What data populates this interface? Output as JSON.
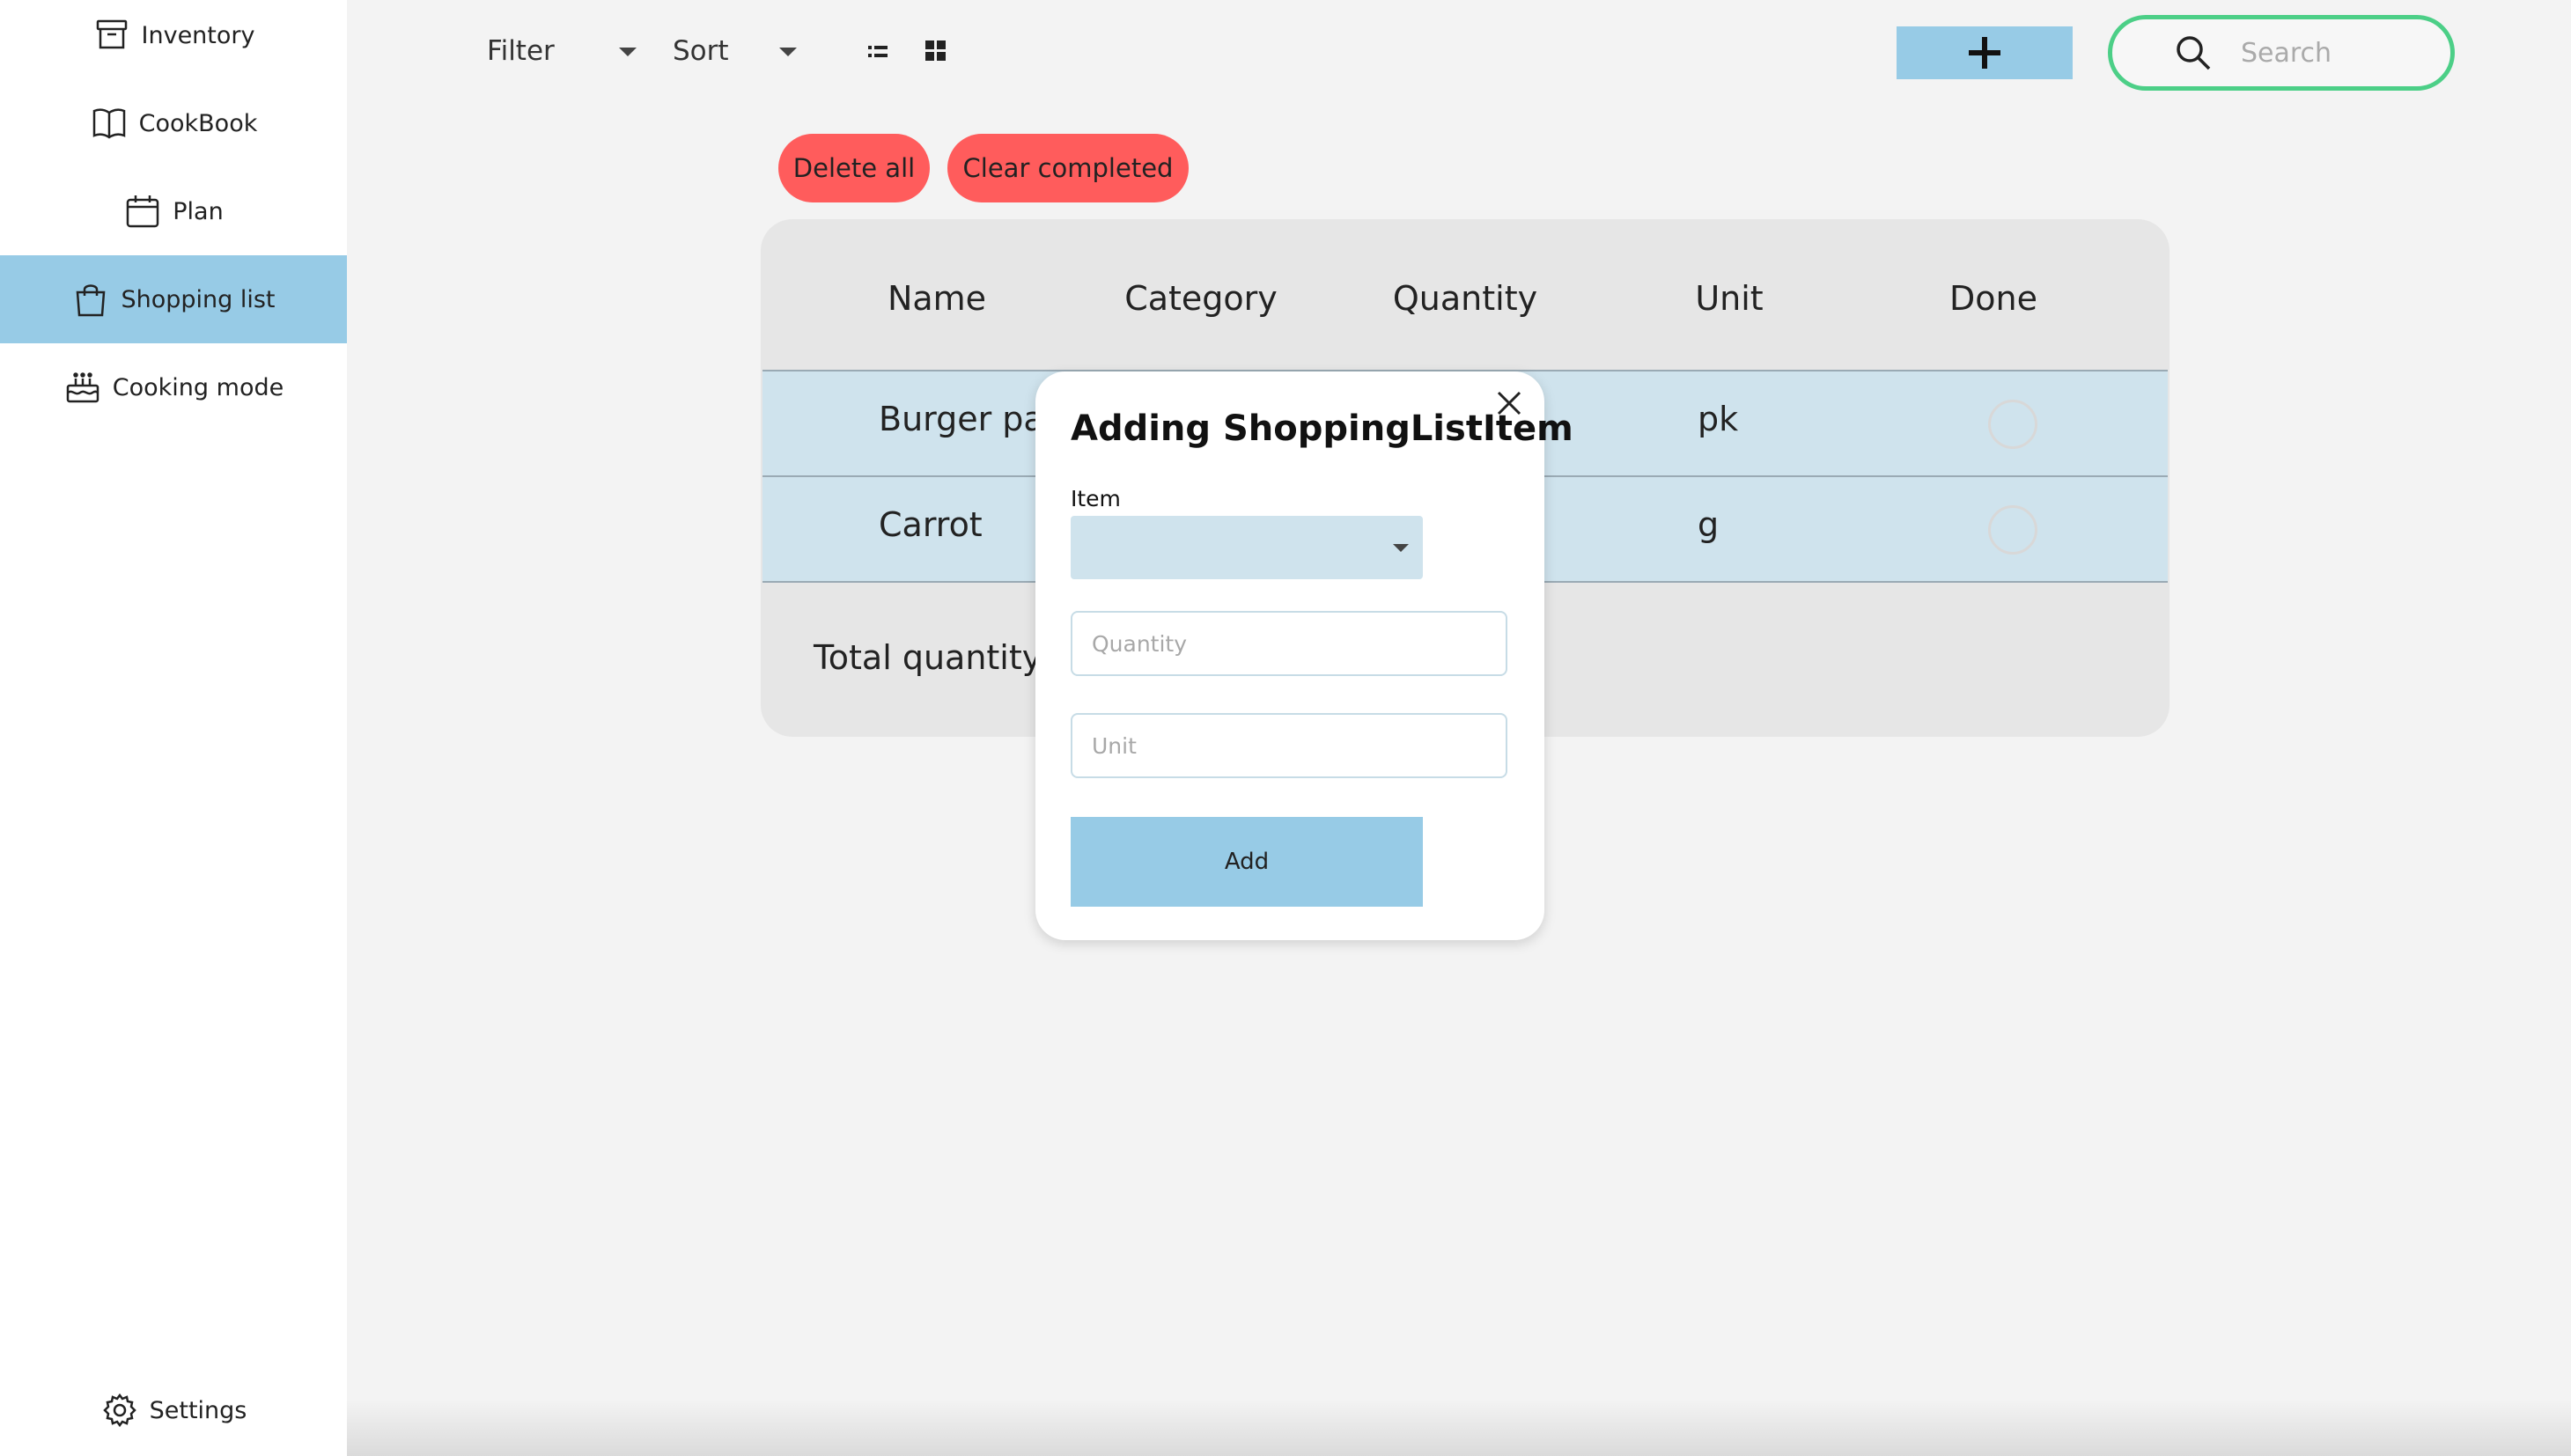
{
  "sidebar": {
    "items": [
      {
        "label": "Inventory",
        "icon": "archive-box-icon"
      },
      {
        "label": "CookBook",
        "icon": "open-book-icon"
      },
      {
        "label": "Plan",
        "icon": "calendar-icon"
      },
      {
        "label": "Shopping list",
        "icon": "shopping-bag-icon",
        "active": true
      },
      {
        "label": "Cooking mode",
        "icon": "cake-icon"
      }
    ],
    "settings_label": "Settings"
  },
  "toolbar": {
    "filter_label": "Filter",
    "sort_label": "Sort",
    "search_placeholder": "Search"
  },
  "actions": {
    "delete_all_label": "Delete all",
    "clear_completed_label": "Clear completed"
  },
  "table": {
    "headers": [
      "Name",
      "Category",
      "Quantity",
      "Unit",
      "Done"
    ],
    "rows": [
      {
        "name": "Burger pa",
        "unit": "pk",
        "done": false
      },
      {
        "name": "Carrot",
        "unit": "g",
        "done": false
      }
    ],
    "total_label": "Total quantity"
  },
  "modal": {
    "title": "Adding ShoppingListItem",
    "item_label": "Item",
    "item_value": "",
    "quantity_placeholder": "Quantity",
    "unit_placeholder": "Unit",
    "add_label": "Add"
  },
  "colors": {
    "accent": "#97cbe6",
    "danger": "#ff5c5c",
    "search_border": "#4ccf87",
    "row_bg": "#cfe3ed"
  }
}
